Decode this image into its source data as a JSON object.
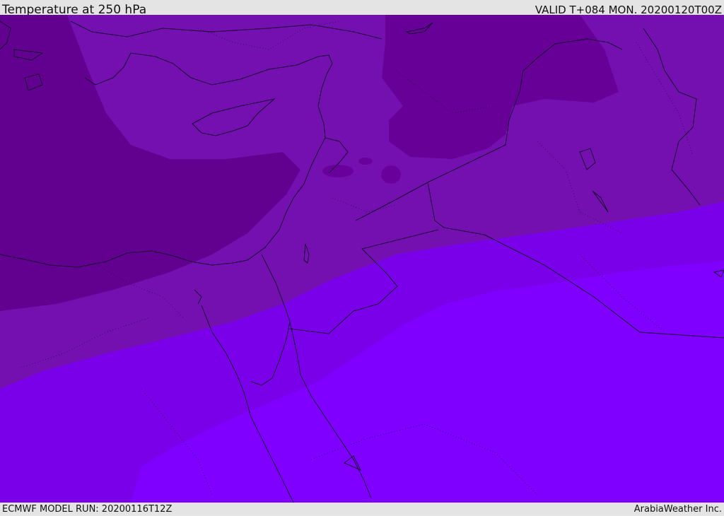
{
  "header": {
    "title": "Temperature at 250 hPa",
    "valid_time": "VALID T+084 MON. 20200120T00Z"
  },
  "footer": {
    "model_run": "ECMWF MODEL RUN: 20200116T12Z",
    "credit": "ArabiaWeather Inc."
  },
  "map": {
    "variable": "temperature",
    "level": "250 hPa",
    "colors": {
      "coldest": "#62008f",
      "cold": "#7510b3",
      "mid": "#7d00d6",
      "mild": "#7c00ee",
      "warm": "#7f00ff",
      "border_line": "#1a0033"
    }
  }
}
